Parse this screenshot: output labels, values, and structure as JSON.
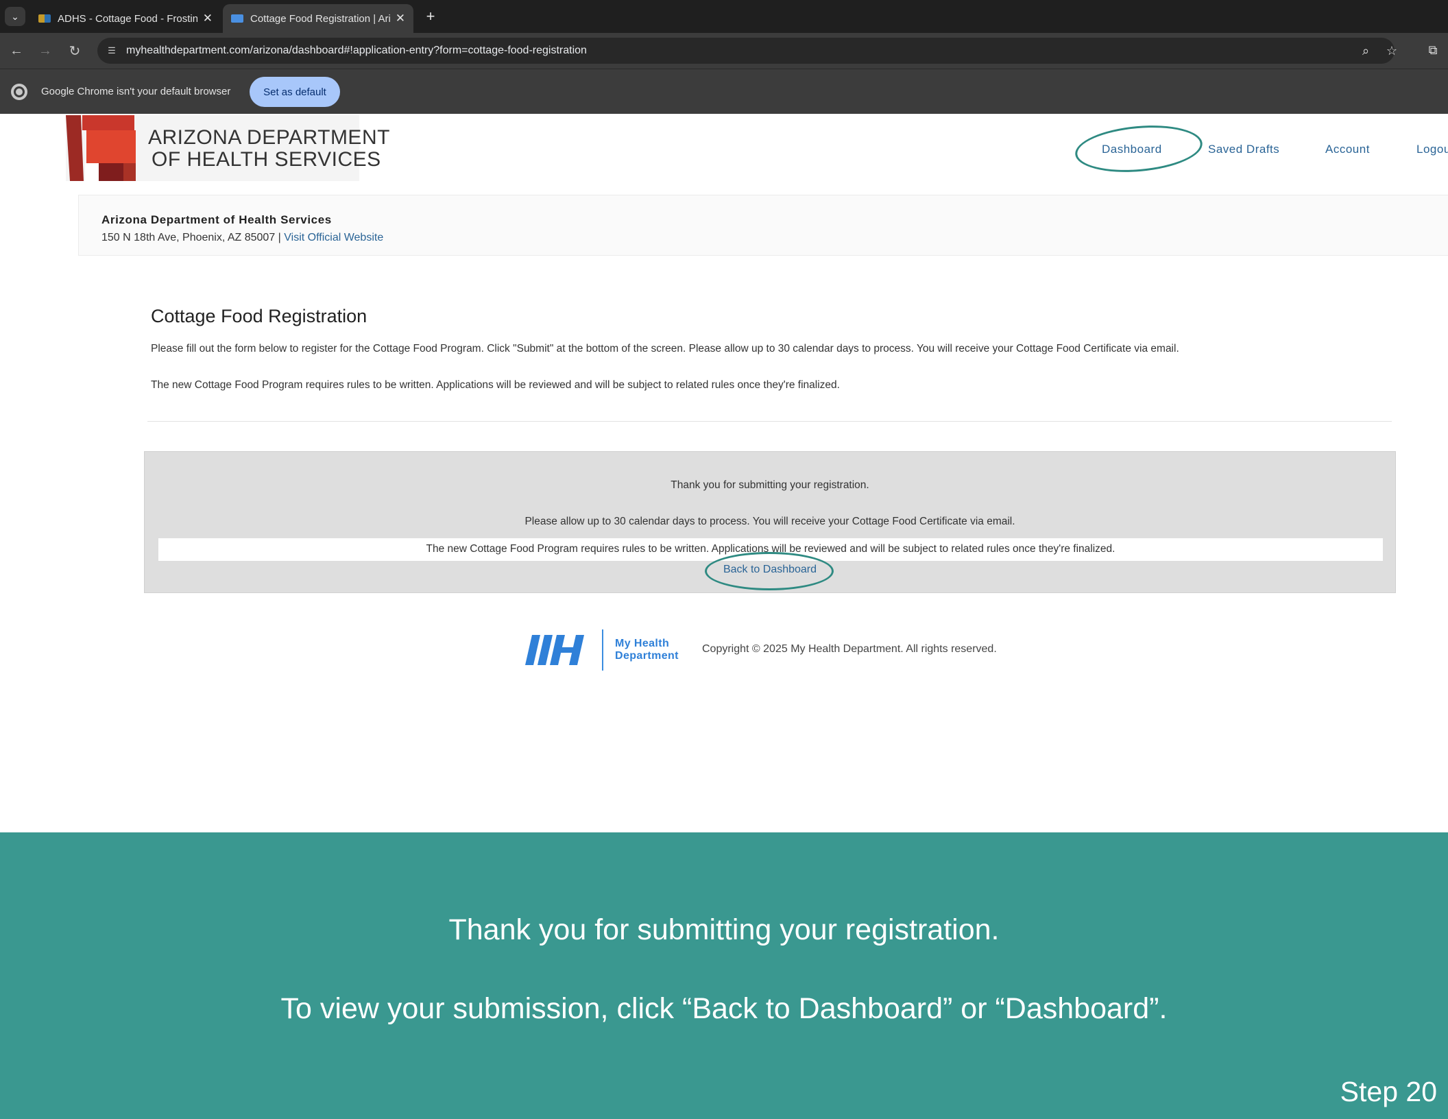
{
  "browser": {
    "tabs": [
      {
        "title": "ADHS - Cottage Food - Frosting",
        "active": false
      },
      {
        "title": "Cottage Food Registration | Arizona",
        "active": true
      }
    ],
    "url": "myhealthdepartment.com/arizona/dashboard#!application-entry?form=cottage-food-registration",
    "infobar": {
      "message": "Google Chrome isn't your default browser",
      "button": "Set as default"
    }
  },
  "site": {
    "logo_line1": "ARIZONA DEPARTMENT",
    "logo_line2": "OF HEALTH SERVICES",
    "nav": [
      "Dashboard",
      "Saved Drafts",
      "Account",
      "Logout"
    ]
  },
  "agency": {
    "name": "Arizona Department of Health Services",
    "address": "150 N 18th Ave, Phoenix, AZ 85007 | ",
    "link": "Visit Official Website"
  },
  "form": {
    "title": "Cottage Food Registration",
    "desc1": "Please fill out the form below to register for the Cottage Food Program. Click \"Submit\" at the bottom of the screen. Please allow up to 30 calendar days to process. You will receive your Cottage Food Certificate via email.",
    "desc2": "The new Cottage Food Program requires rules to be written. Applications will be reviewed and will be subject to related rules once they're finalized."
  },
  "confirmation": {
    "thanks": "Thank you for submitting your registration.",
    "process": "Please allow up to 30 calendar days to process. You will receive your Cottage Food Certificate via email.",
    "rules": "The new Cottage Food Program requires rules to be written. Applications will be reviewed and will be subject to related rules once they're finalized.",
    "back": "Back to Dashboard"
  },
  "footer": {
    "brand_line1": "My Health",
    "brand_line2": "Department",
    "copyright": "Copyright © 2025 My Health Department. All rights reserved."
  },
  "tutorial": {
    "line1": "Thank you for submitting your registration.",
    "line2": "To view your submission, click “Back to Dashboard” or “Dashboard”.",
    "step": "Step 20"
  },
  "colors": {
    "banner": "#3a9890",
    "annotation": "#2e8a82",
    "link": "#2a6496",
    "logo_red": "#d93a2b",
    "logo_dark_red": "#8b1f1f"
  }
}
